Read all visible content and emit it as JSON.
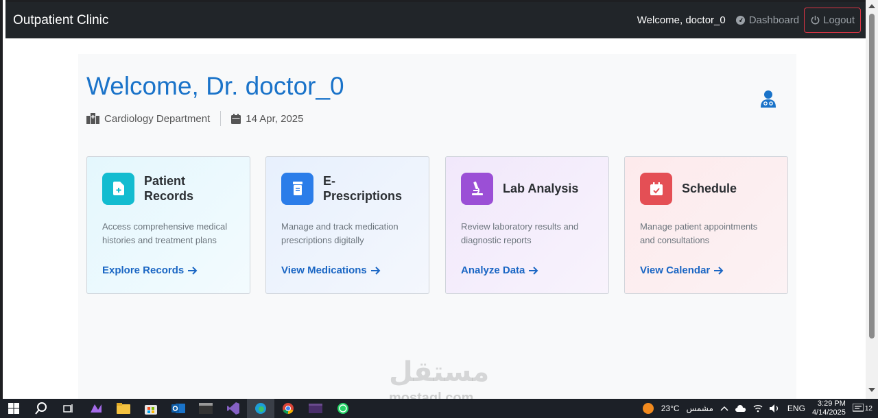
{
  "navbar": {
    "brand": "Outpatient Clinic",
    "welcome": "Welcome, doctor_0",
    "dashboard": "Dashboard",
    "logout": "Logout"
  },
  "hero": {
    "title": "Welcome, Dr. doctor_0",
    "department": "Cardiology Department",
    "date": "14 Apr, 2025"
  },
  "cards": [
    {
      "title_line1": "Patient",
      "title_line2": "Records",
      "desc": "Access comprehensive medical histories and treatment plans",
      "link": "Explore Records",
      "color": "#13bcd0"
    },
    {
      "title": "E-Prescriptions",
      "desc": "Manage and track medication prescriptions digitally",
      "link": "View Medications",
      "color": "#2b7de9"
    },
    {
      "title": "Lab Analysis",
      "desc": "Review laboratory results and diagnostic reports",
      "link": "Analyze Data",
      "color": "#9b4fd6"
    },
    {
      "title": "Schedule",
      "desc": "Manage patient appointments and consultations",
      "link": "View Calendar",
      "color": "#e44f55"
    }
  ],
  "watermark": {
    "arabic": "مستقل",
    "latin": "mostaql.com"
  },
  "taskbar": {
    "weather_temp": "23°C",
    "weather_text": "مشمس",
    "language": "ENG",
    "time": "3:29 PM",
    "date": "4/14/2025",
    "notifications": "12"
  },
  "colors": {
    "navbar": "#212529",
    "title": "#1a73c9",
    "link": "#1a66c4",
    "logout_border": "#dc3545"
  }
}
